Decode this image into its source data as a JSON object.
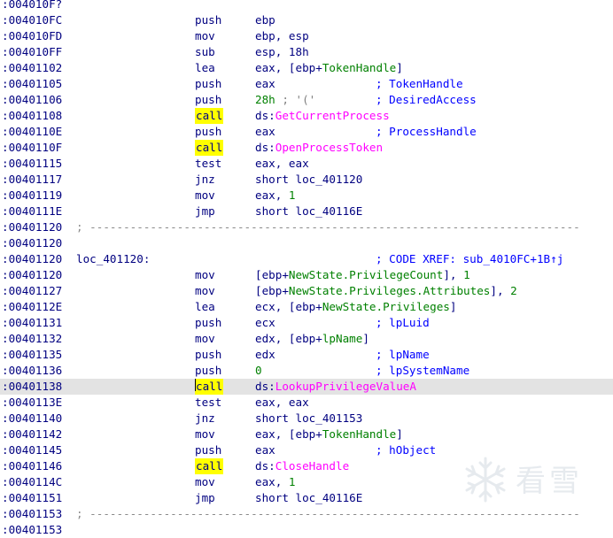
{
  "lines": [
    {
      "addr": ":004010F?",
      "mn": "",
      "ops": []
    },
    {
      "addr": ":004010FC",
      "mn": "push",
      "ops": [
        {
          "t": "ebp"
        }
      ]
    },
    {
      "addr": ":004010FD",
      "mn": "mov",
      "ops": [
        {
          "t": "ebp, esp"
        }
      ]
    },
    {
      "addr": ":004010FF",
      "mn": "sub",
      "ops": [
        {
          "t": "esp, 18h"
        }
      ]
    },
    {
      "addr": ":00401102",
      "mn": "lea",
      "ops": [
        {
          "t": "eax, [ebp+"
        },
        {
          "t": "TokenHandle",
          "c": "mem"
        },
        {
          "t": "]"
        }
      ]
    },
    {
      "addr": ":00401105",
      "mn": "push",
      "ops": [
        {
          "t": "eax"
        }
      ],
      "cmt": "; TokenHandle"
    },
    {
      "addr": ":00401106",
      "mn": "push",
      "ops": [
        {
          "t": "28h",
          "c": "num"
        },
        {
          "t": " ; '('",
          "c": "gray"
        }
      ],
      "cmt": "; DesiredAccess"
    },
    {
      "addr": ":00401108",
      "mn": "call",
      "call": true,
      "ops": [
        {
          "t": "ds:"
        },
        {
          "t": "GetCurrentProcess",
          "c": "fn"
        }
      ]
    },
    {
      "addr": ":0040110E",
      "mn": "push",
      "ops": [
        {
          "t": "eax"
        }
      ],
      "cmt": "; ProcessHandle"
    },
    {
      "addr": ":0040110F",
      "mn": "call",
      "call": true,
      "ops": [
        {
          "t": "ds:"
        },
        {
          "t": "OpenProcessToken",
          "c": "fn"
        }
      ]
    },
    {
      "addr": ":00401115",
      "mn": "test",
      "ops": [
        {
          "t": "eax, eax"
        }
      ]
    },
    {
      "addr": ":00401117",
      "mn": "jnz",
      "ops": [
        {
          "t": "short loc_401120"
        }
      ]
    },
    {
      "addr": ":00401119",
      "mn": "mov",
      "ops": [
        {
          "t": "eax, "
        },
        {
          "t": "1",
          "c": "num"
        }
      ]
    },
    {
      "addr": ":0040111E",
      "mn": "jmp",
      "ops": [
        {
          "t": "short loc_40116E"
        }
      ]
    },
    {
      "addr": ":00401120",
      "sep": "; -------------------------------------------------------------------------"
    },
    {
      "addr": ":00401120",
      "mn": "",
      "ops": []
    },
    {
      "addr": ":00401120",
      "label": "loc_401120:",
      "xref": "; CODE XREF: sub_4010FC+1B↑j"
    },
    {
      "addr": ":00401120",
      "mn": "mov",
      "ops": [
        {
          "t": "[ebp+"
        },
        {
          "t": "NewState.PrivilegeCount",
          "c": "mem"
        },
        {
          "t": "], "
        },
        {
          "t": "1",
          "c": "num"
        }
      ]
    },
    {
      "addr": ":00401127",
      "mn": "mov",
      "ops": [
        {
          "t": "[ebp+"
        },
        {
          "t": "NewState.Privileges.Attributes",
          "c": "mem"
        },
        {
          "t": "], "
        },
        {
          "t": "2",
          "c": "num"
        }
      ]
    },
    {
      "addr": ":0040112E",
      "mn": "lea",
      "ops": [
        {
          "t": "ecx, [ebp+"
        },
        {
          "t": "NewState.Privileges",
          "c": "mem"
        },
        {
          "t": "]"
        }
      ]
    },
    {
      "addr": ":00401131",
      "mn": "push",
      "ops": [
        {
          "t": "ecx"
        }
      ],
      "cmt": "; lpLuid"
    },
    {
      "addr": ":00401132",
      "mn": "mov",
      "ops": [
        {
          "t": "edx, [ebp+"
        },
        {
          "t": "lpName",
          "c": "mem"
        },
        {
          "t": "]"
        }
      ]
    },
    {
      "addr": ":00401135",
      "mn": "push",
      "ops": [
        {
          "t": "edx"
        }
      ],
      "cmt": "; lpName"
    },
    {
      "addr": ":00401136",
      "mn": "push",
      "ops": [
        {
          "t": "0",
          "c": "num"
        }
      ],
      "cmt": "; lpSystemName"
    },
    {
      "addr": ":00401138",
      "mn": "call",
      "call": true,
      "highlight": true,
      "cursor": true,
      "ops": [
        {
          "t": "ds:"
        },
        {
          "t": "LookupPrivilegeValueA",
          "c": "fn"
        }
      ]
    },
    {
      "addr": ":0040113E",
      "mn": "test",
      "ops": [
        {
          "t": "eax, eax"
        }
      ]
    },
    {
      "addr": ":00401140",
      "mn": "jnz",
      "ops": [
        {
          "t": "short loc_401153"
        }
      ]
    },
    {
      "addr": ":00401142",
      "mn": "mov",
      "ops": [
        {
          "t": "eax, [ebp+"
        },
        {
          "t": "TokenHandle",
          "c": "mem"
        },
        {
          "t": "]"
        }
      ]
    },
    {
      "addr": ":00401145",
      "mn": "push",
      "ops": [
        {
          "t": "eax"
        }
      ],
      "cmt": "; hObject"
    },
    {
      "addr": ":00401146",
      "mn": "call",
      "call": true,
      "ops": [
        {
          "t": "ds:"
        },
        {
          "t": "CloseHandle",
          "c": "fn"
        }
      ]
    },
    {
      "addr": ":0040114C",
      "mn": "mov",
      "ops": [
        {
          "t": "eax, "
        },
        {
          "t": "1",
          "c": "num"
        }
      ]
    },
    {
      "addr": ":00401151",
      "mn": "jmp",
      "ops": [
        {
          "t": "short loc_40116E"
        }
      ]
    },
    {
      "addr": ":00401153",
      "sep": "; -------------------------------------------------------------------------"
    },
    {
      "addr": ":00401153",
      "mn": "",
      "ops": []
    }
  ],
  "watermark": {
    "text": "看雪",
    "icon": "snowflake-icon",
    "color": "#b8c4d0"
  },
  "colors": {
    "address": "#000080",
    "function_name": "#ff00ff",
    "struct_member": "#008000",
    "comment": "#0000ff",
    "call_highlight": "#ffff00",
    "selected_line": "#e3e3e3"
  }
}
